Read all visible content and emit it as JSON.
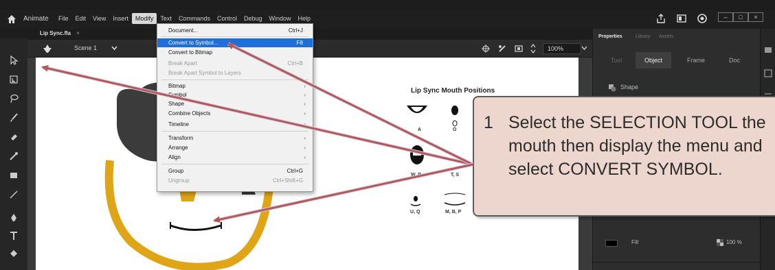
{
  "menubar": {
    "app_name": "Animate",
    "items": [
      "File",
      "Edit",
      "View",
      "Insert",
      "Modify",
      "Text",
      "Commands",
      "Control",
      "Debug",
      "Window",
      "Help"
    ],
    "active_item": "Modify"
  },
  "document": {
    "tab_label": "Lip Sync.fla",
    "tab_close": "×"
  },
  "scene": {
    "label": "Scene 1",
    "zoom": "100%"
  },
  "stage": {
    "title": "Lip Sync Mouth Positions",
    "mouth_labels": [
      "A",
      "O",
      "W, R",
      "T, S",
      "U, Q",
      "M, B, P"
    ]
  },
  "modify_menu": {
    "items": [
      {
        "label": "Document...",
        "shortcut": "Ctrl+J",
        "state": "normal"
      },
      {
        "label": "Convert to Symbol...",
        "shortcut": "F8",
        "state": "highlight"
      },
      {
        "label": "Convert to Bitmap",
        "shortcut": "",
        "state": "normal"
      },
      {
        "label": "Break Apart",
        "shortcut": "Ctrl+B",
        "state": "disabled"
      },
      {
        "label": "Break Apart Symbol to Layers",
        "shortcut": "",
        "state": "disabled"
      },
      {
        "label": "Bitmap",
        "submenu": true
      },
      {
        "label": "Symbol",
        "submenu": true
      },
      {
        "label": "Shape",
        "submenu": true
      },
      {
        "label": "Combine Objects",
        "submenu": true
      },
      {
        "label": "Timeline",
        "submenu": true
      },
      {
        "label": "Transform",
        "submenu": true
      },
      {
        "label": "Arrange",
        "submenu": true
      },
      {
        "label": "Align",
        "submenu": true
      },
      {
        "label": "Group",
        "shortcut": "Ctrl+G",
        "state": "normal"
      },
      {
        "label": "Ungroup",
        "shortcut": "Ctrl+Shift+G",
        "state": "disabled"
      }
    ]
  },
  "properties_panel": {
    "tabs": [
      "Properties",
      "Library",
      "Assets"
    ],
    "subtabs": [
      "Tool",
      "Object",
      "Frame",
      "Doc"
    ],
    "active_subtab": "Object",
    "shape_label": "Shape",
    "fill_label": "Fill",
    "fill_opacity": "100 %"
  },
  "callout": {
    "number": "1",
    "text": "Select the SELECTION TOOL the mouth then display the menu and select CONVERT SYMBOL."
  },
  "colors": {
    "accent_highlight": "#1e6fd9",
    "arrow": "#b25a5a",
    "callout_bg": "#ecd6cd",
    "hair": "#3b3b3b",
    "face_outline": "#e0a417"
  }
}
